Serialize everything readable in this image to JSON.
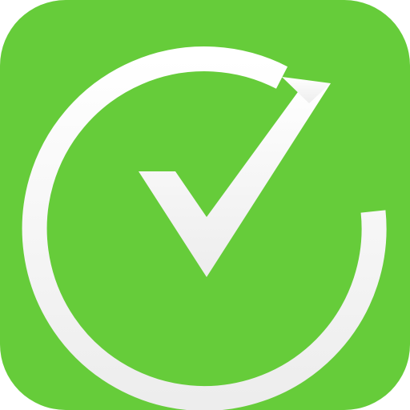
{
  "app_icon": {
    "icon": "check-circle-icon",
    "colors": {
      "background": "#66CC3A",
      "mark": "#FFFFFF",
      "mark_shadow": "#E7E7E7"
    }
  }
}
